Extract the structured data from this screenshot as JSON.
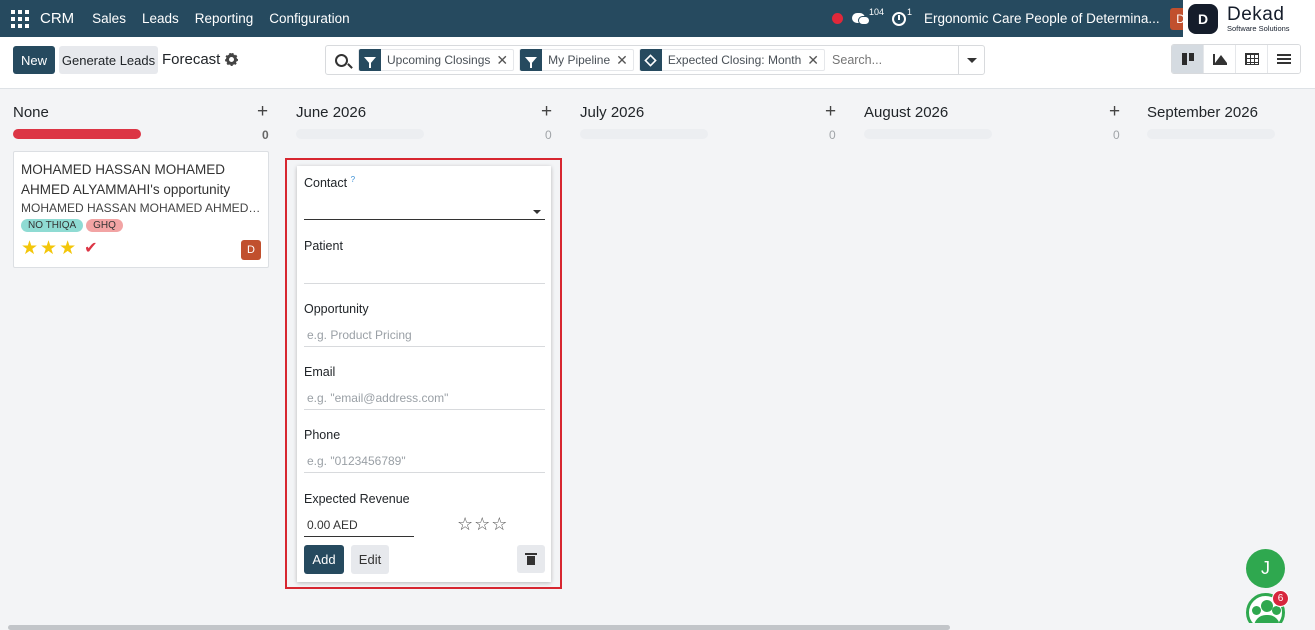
{
  "navbar": {
    "brand": "CRM",
    "menu": [
      "Sales",
      "Leads",
      "Reporting",
      "Configuration"
    ],
    "messages_count": "104",
    "activities_count": "1",
    "company": "Ergonomic Care People of Determina...",
    "user_initial": "D",
    "logo_mark": "D",
    "logo_name": "Dekad",
    "logo_tagline": "Software Solutions"
  },
  "control": {
    "new_label": "New",
    "generate_label": "Generate Leads",
    "view_title": "Forecast",
    "facets": [
      {
        "icon": "filter-icon",
        "label": "Upcoming Closings"
      },
      {
        "icon": "filter-icon",
        "label": "My Pipeline"
      },
      {
        "icon": "group-by-icon",
        "label": "Expected Closing: Month"
      }
    ],
    "search_placeholder": "Search...",
    "views": [
      "kanban",
      "graph",
      "pivot",
      "list"
    ],
    "active_view": "kanban"
  },
  "columns": [
    {
      "title": "None",
      "count": "0",
      "bar_color": "#dc3545"
    },
    {
      "title": "June 2026",
      "count": "0"
    },
    {
      "title": "July 2026",
      "count": "0"
    },
    {
      "title": "August 2026",
      "count": "0"
    },
    {
      "title": "September 2026",
      "count": ""
    }
  ],
  "card": {
    "title": "MOHAMED HASSAN MOHAMED AHMED ALYAMMAHI's opportunity",
    "subtitle": "MOHAMED HASSAN MOHAMED AHMED A...",
    "tags": [
      "NO THIQA",
      "GHQ"
    ],
    "stars_filled": 3,
    "avatar": "D"
  },
  "quick_create": {
    "contact_label": "Contact",
    "contact_help": "?",
    "patient_label": "Patient",
    "opportunity_label": "Opportunity",
    "opportunity_placeholder": "e.g. Product Pricing",
    "email_label": "Email",
    "email_placeholder": "e.g. \"email@address.com\"",
    "phone_label": "Phone",
    "phone_placeholder": "e.g. \"0123456789\"",
    "revenue_label": "Expected Revenue",
    "revenue_value": "0.00 AED",
    "priority_stars": 0,
    "add_label": "Add",
    "edit_label": "Edit"
  },
  "floating": {
    "chat_initial": "J",
    "group_badge": "6"
  },
  "colors": {
    "navbar": "#264a5f",
    "primary": "#264a5f",
    "highlight": "#d72630",
    "star": "#f3c60a"
  }
}
